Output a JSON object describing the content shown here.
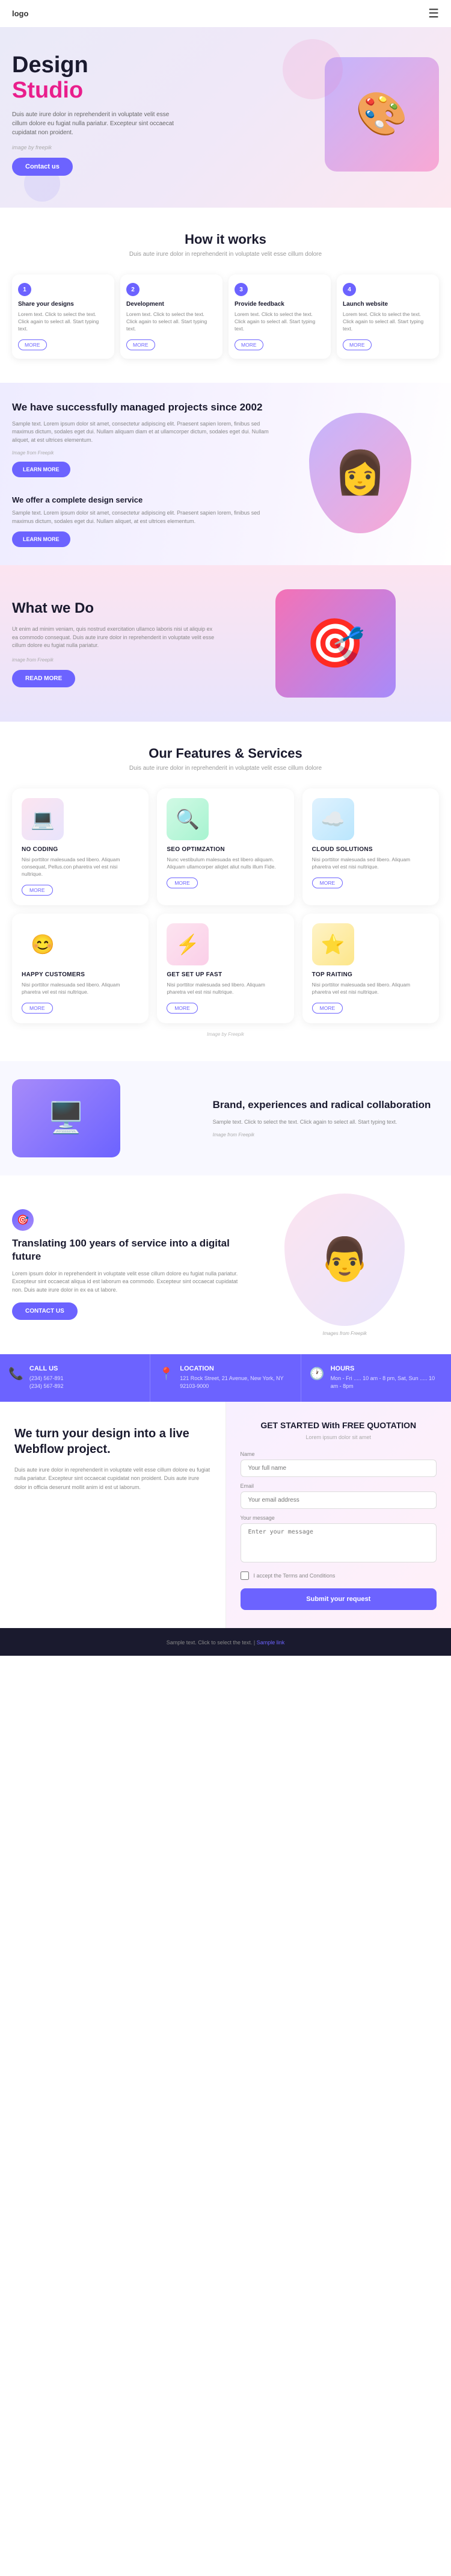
{
  "header": {
    "logo": "logo",
    "menu_icon": "☰"
  },
  "hero": {
    "title_line1": "Design",
    "title_line2": "Studio",
    "description": "Duis aute irure dolor in reprehenderit in voluptate velit esse cillum dolore eu fugiat nulla pariatur. Excepteur sint occaecat cupidatat non proident.",
    "image_credit": "image by freepik",
    "cta_label": "Contact us"
  },
  "how_it_works": {
    "title": "How it works",
    "subtitle": "Duis aute irure dolor in reprehenderit in voluptate velit esse cillum dolore",
    "steps": [
      {
        "num": "1",
        "title": "Share your designs",
        "desc": "Lorem text. Click to select the text. Click again to select all. Start typing text.",
        "btn": "MORE"
      },
      {
        "num": "2",
        "title": "Development",
        "desc": "Lorem text. Click to select the text. Click again to select all. Start typing text.",
        "btn": "MORE"
      },
      {
        "num": "3",
        "title": "Provide feedback",
        "desc": "Lorem text. Click to select the text. Click again to select all. Start typing text.",
        "btn": "MORE"
      },
      {
        "num": "4",
        "title": "Launch website",
        "desc": "Lorem text. Click to select the text. Click again to select all. Start typing text.",
        "btn": "MORE"
      }
    ]
  },
  "managed": {
    "title": "We have successfully managed projects since 2002",
    "desc": "Sample text. Lorem ipsum dolor sit amet, consectetur adipiscing elit. Praesent sapien lorem, finibus sed maximus dictum, sodales eget dui. Nullam aliquam diam et at ullamcorper dictum, sodales eget dui. Nullam aliquet, at est ultrices elementum.",
    "credit": "Image from Freepik",
    "learn_more": "LEARN MORE",
    "service_title": "We offer a complete design service",
    "service_desc": "Sample text. Lorem ipsum dolor sit amet, consectetur adipiscing elit. Praesent sapien lorem, finibus sed maximus dictum, sodales eget dui. Nullam aliquet, at est ultrices elementum.",
    "service_learn_more": "LEARN MORE"
  },
  "what_we_do": {
    "label": "What we Do",
    "desc": "Ut enim ad minim veniam, quis nostrud exercitation ullamco laboris nisi ut aliquip ex ea commodo consequat. Duis aute irure dolor in reprehenderit in voluptate velit esse cillum dolore eu fugiat nulla pariatur.",
    "credit": "image from Freepik",
    "read_more": "READ MORE"
  },
  "features": {
    "title": "Our Features & Services",
    "subtitle": "Duis aute irure dolor in reprehenderit in voluptate velit esse cillum dolore",
    "credit_bottom": "Image by Freepik",
    "items": [
      {
        "icon": "💻",
        "title": "NO CODING",
        "desc": "Nisi porttitor malesuada sed libero. Aliquam consequat, Pellus.con pharetra vel est nisi nultrique.",
        "btn": "MORE"
      },
      {
        "icon": "🔍",
        "title": "SEO OPTIMZATION",
        "desc": "Nunc vestibulum malesuada est libero aliquam. Aliquam ullamcorper aliqtet aliut nulls illum Fide.",
        "btn": "MORE"
      },
      {
        "icon": "☁️",
        "title": "CLOUD SOLUTIONS",
        "desc": "Nisi porttitor malesuada sed libero. Aliquam pharetra vel est nisi nultrique.",
        "btn": "MORE"
      },
      {
        "icon": "😊",
        "title": "HAPPY CUSTOMERS",
        "desc": "Nisi porttitor malesuada sed libero. Aliquam pharetra vel est nisi nultrique.",
        "btn": "MORE"
      },
      {
        "icon": "⚡",
        "title": "GET SET UP FAST",
        "desc": "Nisi porttitor malesuada sed libero. Aliquam pharetra vel est nisi nultrique.",
        "btn": "MORE"
      },
      {
        "icon": "⭐",
        "title": "TOP RAITING",
        "desc": "Nisi porttitor malesuada sed libero. Aliquam pharetra vel est nisi nultrique.",
        "btn": "MORE"
      }
    ]
  },
  "brand": {
    "title": "Brand, experiences and radical collaboration",
    "desc": "Sample text. Click to select the text. Click again to select all. Start typing text.",
    "credit": "Image from Freepik"
  },
  "digital": {
    "icon": "🎯",
    "title": "Translating 100 years of service into a digital future",
    "desc": "Lorem ipsum dolor in reprehenderit in voluptate velit esse cillum dolore eu fugiat nulla pariatur. Excepteur sint occaecat aliqua id est laborum ea commodo. Excepteur sint occaecat cupidatat non. Duis aute irure dolor in ex ea ut labore.",
    "cta": "CONTACT US",
    "image_credit": "Images from Freepik"
  },
  "contact_row": {
    "items": [
      {
        "icon": "📞",
        "label": "CALL US",
        "value": "(234) 567-891\n(234) 567-892"
      },
      {
        "icon": "📍",
        "label": "LOCATION",
        "value": "121 Rock Street, 21 Avenue, New York, NY 92103-9000"
      },
      {
        "icon": "🕐",
        "label": "HOURS",
        "value": "Mon - Fri ..... 10 am - 8 pm, Sat, Sun ..... 10 am - 8pm"
      }
    ]
  },
  "webflow": {
    "title": "We turn your design into a live Webflow project.",
    "desc": "Duis aute irure dolor in reprehenderit in voluptate velit esse cillum dolore eu fugiat nulla pariatur. Excepteur sint occaecat cupidatat non proident. Duis aute irure dolor in officia deserunt mollit anim id est ut laborum."
  },
  "quotation": {
    "title": "GET STARTED With FREE QUOTATION",
    "subtitle": "Lorem ipsum dolor sit amet",
    "form": {
      "name_label": "Name",
      "name_placeholder": "Your full name",
      "email_label": "Email",
      "email_placeholder": "Your email address",
      "message_label": "Your message",
      "message_placeholder": "Enter your message",
      "checkbox_label": "I accept the Terms and Conditions",
      "submit_label": "Submit your request"
    }
  },
  "footer": {
    "text": "Sample text. Click to select the text. | ",
    "link_text": "Sample link"
  }
}
